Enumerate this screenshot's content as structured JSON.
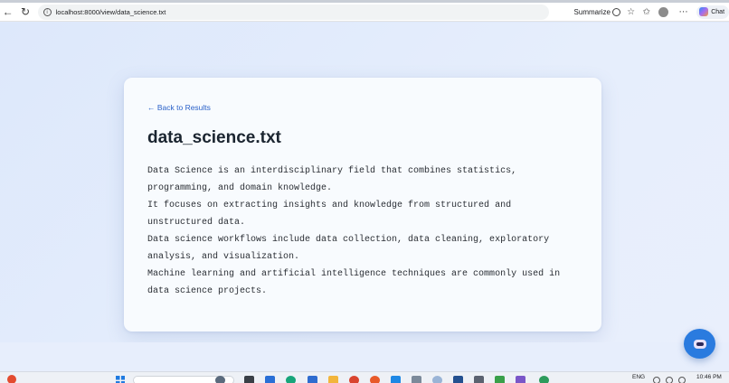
{
  "browser": {
    "url": "localhost:8000/view/data_science.txt",
    "summarize_label": "Summarize",
    "chat_label": "Chat"
  },
  "page": {
    "back_link": "← Back to Results",
    "file_title": "data_science.txt",
    "lines": [
      "Data Science is an interdisciplinary field that combines statistics, programming, and domain knowledge.",
      "It focuses on extracting insights and knowledge from structured and unstructured data.",
      "Data science workflows include data collection, data cleaning, exploratory analysis, and visualization.",
      "Machine learning and artificial intelligence techniques are commonly used in data science projects."
    ]
  },
  "taskbar": {
    "language": "ENG",
    "time": "10:46 PM"
  },
  "colors": {
    "link": "#2b62c9",
    "fab": "#2a7bdf",
    "background": "#dfe9fb",
    "card": "#f8fbfe"
  },
  "icons": [
    "back-icon",
    "reload-icon",
    "site-info-icon",
    "summarize-icon",
    "favorite-icon",
    "favorites-icon",
    "profile-icon",
    "more-icon",
    "copilot-icon",
    "robot-icon",
    "start-icon",
    "search-icon"
  ]
}
